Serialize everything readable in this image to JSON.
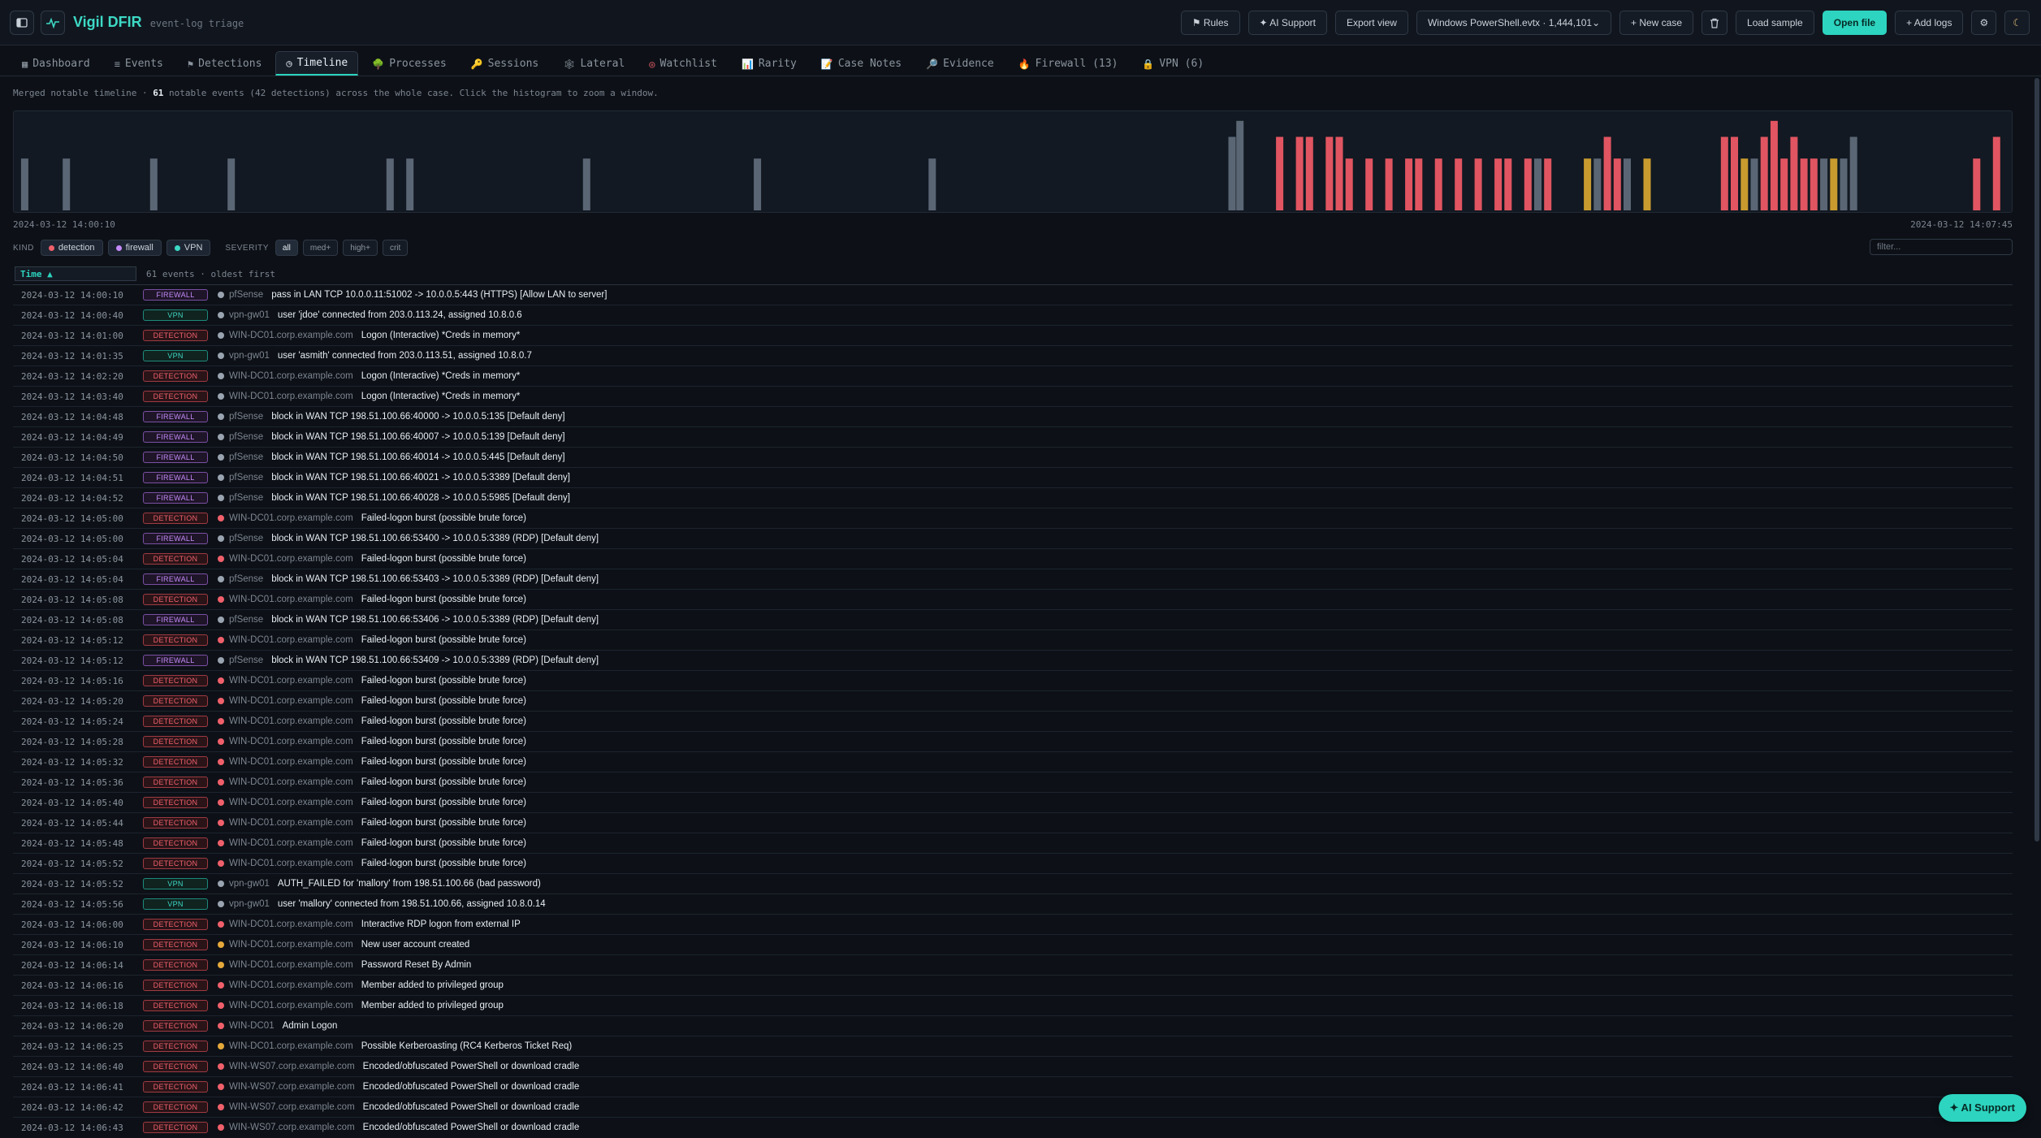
{
  "app": {
    "name": "Vigil DFIR",
    "subtitle": "event-log triage"
  },
  "toolbar": {
    "rules": "⚑ Rules",
    "ai_support": "✦ AI Support",
    "export_view": "Export view",
    "dataset_select": "Windows PowerShell.evtx · 1,444,101",
    "new_case": "+ New case",
    "load_sample": "Load sample",
    "open_file": "Open file",
    "add_logs": "+ Add logs"
  },
  "tabs": [
    {
      "icon": "▦",
      "label": "Dashboard"
    },
    {
      "icon": "≡",
      "label": "Events"
    },
    {
      "icon": "⚑",
      "label": "Detections"
    },
    {
      "icon": "◷",
      "label": "Timeline"
    },
    {
      "icon": "🌳",
      "label": "Processes"
    },
    {
      "icon": "🔑",
      "label": "Sessions"
    },
    {
      "icon": "🕸",
      "label": "Lateral"
    },
    {
      "icon": "◎",
      "label": "Watchlist"
    },
    {
      "icon": "📊",
      "label": "Rarity"
    },
    {
      "icon": "📝",
      "label": "Case Notes"
    },
    {
      "icon": "🔎",
      "label": "Evidence"
    },
    {
      "icon": "🔥",
      "label": "Firewall (13)"
    },
    {
      "icon": "🔒",
      "label": "VPN (6)"
    }
  ],
  "summary": {
    "prefix": "Merged notable timeline · ",
    "count": "61",
    "suffix": " notable events (42 detections) across the whole case. Click the histogram to zoom a window."
  },
  "histogram": {
    "start_label": "2024-03-12 14:00:10",
    "end_label": "2024-03-12 14:07:45",
    "colors": {
      "low": "#5b6675",
      "medium": "#c99a2e",
      "high": "#e05561"
    },
    "buckets": [
      {
        "t": 0.002,
        "v": 0.55,
        "sev": "low"
      },
      {
        "t": 0.023,
        "v": 0.55,
        "sev": "low"
      },
      {
        "t": 0.067,
        "v": 0.55,
        "sev": "low"
      },
      {
        "t": 0.106,
        "v": 0.55,
        "sev": "low"
      },
      {
        "t": 0.186,
        "v": 0.55,
        "sev": "low"
      },
      {
        "t": 0.196,
        "v": 0.55,
        "sev": "low"
      },
      {
        "t": 0.285,
        "v": 0.55,
        "sev": "low"
      },
      {
        "t": 0.371,
        "v": 0.55,
        "sev": "low"
      },
      {
        "t": 0.459,
        "v": 0.55,
        "sev": "low"
      },
      {
        "t": 0.61,
        "v": 0.78,
        "sev": "low"
      },
      {
        "t": 0.614,
        "v": 0.95,
        "sev": "low"
      },
      {
        "t": 0.634,
        "v": 0.78,
        "sev": "high"
      },
      {
        "t": 0.644,
        "v": 0.78,
        "sev": "high"
      },
      {
        "t": 0.649,
        "v": 0.78,
        "sev": "high"
      },
      {
        "t": 0.659,
        "v": 0.78,
        "sev": "high"
      },
      {
        "t": 0.664,
        "v": 0.78,
        "sev": "high"
      },
      {
        "t": 0.669,
        "v": 0.55,
        "sev": "high"
      },
      {
        "t": 0.679,
        "v": 0.55,
        "sev": "high"
      },
      {
        "t": 0.689,
        "v": 0.55,
        "sev": "high"
      },
      {
        "t": 0.699,
        "v": 0.55,
        "sev": "high"
      },
      {
        "t": 0.704,
        "v": 0.55,
        "sev": "high"
      },
      {
        "t": 0.714,
        "v": 0.55,
        "sev": "high"
      },
      {
        "t": 0.724,
        "v": 0.55,
        "sev": "high"
      },
      {
        "t": 0.734,
        "v": 0.55,
        "sev": "high"
      },
      {
        "t": 0.744,
        "v": 0.55,
        "sev": "high"
      },
      {
        "t": 0.749,
        "v": 0.55,
        "sev": "high"
      },
      {
        "t": 0.759,
        "v": 0.55,
        "sev": "high"
      },
      {
        "t": 0.764,
        "v": 0.55,
        "sev": "low"
      },
      {
        "t": 0.769,
        "v": 0.55,
        "sev": "high"
      },
      {
        "t": 0.789,
        "v": 0.55,
        "sev": "medium"
      },
      {
        "t": 0.794,
        "v": 0.55,
        "sev": "low"
      },
      {
        "t": 0.799,
        "v": 0.78,
        "sev": "high"
      },
      {
        "t": 0.804,
        "v": 0.55,
        "sev": "high"
      },
      {
        "t": 0.809,
        "v": 0.55,
        "sev": "low"
      },
      {
        "t": 0.819,
        "v": 0.55,
        "sev": "medium"
      },
      {
        "t": 0.858,
        "v": 0.78,
        "sev": "high"
      },
      {
        "t": 0.863,
        "v": 0.78,
        "sev": "high"
      },
      {
        "t": 0.868,
        "v": 0.55,
        "sev": "medium"
      },
      {
        "t": 0.873,
        "v": 0.55,
        "sev": "low"
      },
      {
        "t": 0.878,
        "v": 0.78,
        "sev": "high"
      },
      {
        "t": 0.883,
        "v": 0.95,
        "sev": "high"
      },
      {
        "t": 0.888,
        "v": 0.55,
        "sev": "high"
      },
      {
        "t": 0.893,
        "v": 0.78,
        "sev": "high"
      },
      {
        "t": 0.898,
        "v": 0.55,
        "sev": "high"
      },
      {
        "t": 0.903,
        "v": 0.55,
        "sev": "high"
      },
      {
        "t": 0.908,
        "v": 0.55,
        "sev": "low"
      },
      {
        "t": 0.913,
        "v": 0.55,
        "sev": "medium"
      },
      {
        "t": 0.918,
        "v": 0.55,
        "sev": "low"
      },
      {
        "t": 0.923,
        "v": 0.78,
        "sev": "low"
      },
      {
        "t": 0.985,
        "v": 0.55,
        "sev": "high"
      },
      {
        "t": 0.995,
        "v": 0.78,
        "sev": "high"
      }
    ]
  },
  "filters": {
    "kind_label": "KIND",
    "kinds": [
      {
        "label": "detection",
        "color": "#f0606b"
      },
      {
        "label": "firewall",
        "color": "#c58af9"
      },
      {
        "label": "VPN",
        "color": "#3dd9c5"
      }
    ],
    "severity_label": "SEVERITY",
    "severities": [
      "all",
      "med+",
      "high+",
      "crit"
    ],
    "filter_placeholder": "filter..."
  },
  "table": {
    "sort_label": "Time ▲",
    "count_text": "61 events · oldest first",
    "severity_colors": {
      "info": "#9aa4b1",
      "medium": "#e5a93b",
      "high": "#f0606b"
    },
    "rows": [
      {
        "time": "2024-03-12 14:00:10",
        "kind": "FIREWALL",
        "sev": "info",
        "host": "pfSense",
        "msg": "pass in LAN TCP 10.0.0.11:51002 -> 10.0.0.5:443 (HTTPS) [Allow LAN to server]"
      },
      {
        "time": "2024-03-12 14:00:40",
        "kind": "VPN",
        "sev": "info",
        "host": "vpn-gw01",
        "msg": "user 'jdoe' connected from 203.0.113.24, assigned 10.8.0.6"
      },
      {
        "time": "2024-03-12 14:01:00",
        "kind": "DETECTION",
        "sev": "info",
        "host": "WIN-DC01.corp.example.com",
        "msg": "Logon (Interactive) *Creds in memory*"
      },
      {
        "time": "2024-03-12 14:01:35",
        "kind": "VPN",
        "sev": "info",
        "host": "vpn-gw01",
        "msg": "user 'asmith' connected from 203.0.113.51, assigned 10.8.0.7"
      },
      {
        "time": "2024-03-12 14:02:20",
        "kind": "DETECTION",
        "sev": "info",
        "host": "WIN-DC01.corp.example.com",
        "msg": "Logon (Interactive) *Creds in memory*"
      },
      {
        "time": "2024-03-12 14:03:40",
        "kind": "DETECTION",
        "sev": "info",
        "host": "WIN-DC01.corp.example.com",
        "msg": "Logon (Interactive) *Creds in memory*"
      },
      {
        "time": "2024-03-12 14:04:48",
        "kind": "FIREWALL",
        "sev": "info",
        "host": "pfSense",
        "msg": "block in WAN TCP 198.51.100.66:40000 -> 10.0.0.5:135 [Default deny]"
      },
      {
        "time": "2024-03-12 14:04:49",
        "kind": "FIREWALL",
        "sev": "info",
        "host": "pfSense",
        "msg": "block in WAN TCP 198.51.100.66:40007 -> 10.0.0.5:139 [Default deny]"
      },
      {
        "time": "2024-03-12 14:04:50",
        "kind": "FIREWALL",
        "sev": "info",
        "host": "pfSense",
        "msg": "block in WAN TCP 198.51.100.66:40014 -> 10.0.0.5:445 [Default deny]"
      },
      {
        "time": "2024-03-12 14:04:51",
        "kind": "FIREWALL",
        "sev": "info",
        "host": "pfSense",
        "msg": "block in WAN TCP 198.51.100.66:40021 -> 10.0.0.5:3389 [Default deny]"
      },
      {
        "time": "2024-03-12 14:04:52",
        "kind": "FIREWALL",
        "sev": "info",
        "host": "pfSense",
        "msg": "block in WAN TCP 198.51.100.66:40028 -> 10.0.0.5:5985 [Default deny]"
      },
      {
        "time": "2024-03-12 14:05:00",
        "kind": "DETECTION",
        "sev": "high",
        "host": "WIN-DC01.corp.example.com",
        "msg": "Failed-logon burst (possible brute force)"
      },
      {
        "time": "2024-03-12 14:05:00",
        "kind": "FIREWALL",
        "sev": "info",
        "host": "pfSense",
        "msg": "block in WAN TCP 198.51.100.66:53400 -> 10.0.0.5:3389 (RDP) [Default deny]"
      },
      {
        "time": "2024-03-12 14:05:04",
        "kind": "DETECTION",
        "sev": "high",
        "host": "WIN-DC01.corp.example.com",
        "msg": "Failed-logon burst (possible brute force)"
      },
      {
        "time": "2024-03-12 14:05:04",
        "kind": "FIREWALL",
        "sev": "info",
        "host": "pfSense",
        "msg": "block in WAN TCP 198.51.100.66:53403 -> 10.0.0.5:3389 (RDP) [Default deny]"
      },
      {
        "time": "2024-03-12 14:05:08",
        "kind": "DETECTION",
        "sev": "high",
        "host": "WIN-DC01.corp.example.com",
        "msg": "Failed-logon burst (possible brute force)"
      },
      {
        "time": "2024-03-12 14:05:08",
        "kind": "FIREWALL",
        "sev": "info",
        "host": "pfSense",
        "msg": "block in WAN TCP 198.51.100.66:53406 -> 10.0.0.5:3389 (RDP) [Default deny]"
      },
      {
        "time": "2024-03-12 14:05:12",
        "kind": "DETECTION",
        "sev": "high",
        "host": "WIN-DC01.corp.example.com",
        "msg": "Failed-logon burst (possible brute force)"
      },
      {
        "time": "2024-03-12 14:05:12",
        "kind": "FIREWALL",
        "sev": "info",
        "host": "pfSense",
        "msg": "block in WAN TCP 198.51.100.66:53409 -> 10.0.0.5:3389 (RDP) [Default deny]"
      },
      {
        "time": "2024-03-12 14:05:16",
        "kind": "DETECTION",
        "sev": "high",
        "host": "WIN-DC01.corp.example.com",
        "msg": "Failed-logon burst (possible brute force)"
      },
      {
        "time": "2024-03-12 14:05:20",
        "kind": "DETECTION",
        "sev": "high",
        "host": "WIN-DC01.corp.example.com",
        "msg": "Failed-logon burst (possible brute force)"
      },
      {
        "time": "2024-03-12 14:05:24",
        "kind": "DETECTION",
        "sev": "high",
        "host": "WIN-DC01.corp.example.com",
        "msg": "Failed-logon burst (possible brute force)"
      },
      {
        "time": "2024-03-12 14:05:28",
        "kind": "DETECTION",
        "sev": "high",
        "host": "WIN-DC01.corp.example.com",
        "msg": "Failed-logon burst (possible brute force)"
      },
      {
        "time": "2024-03-12 14:05:32",
        "kind": "DETECTION",
        "sev": "high",
        "host": "WIN-DC01.corp.example.com",
        "msg": "Failed-logon burst (possible brute force)"
      },
      {
        "time": "2024-03-12 14:05:36",
        "kind": "DETECTION",
        "sev": "high",
        "host": "WIN-DC01.corp.example.com",
        "msg": "Failed-logon burst (possible brute force)"
      },
      {
        "time": "2024-03-12 14:05:40",
        "kind": "DETECTION",
        "sev": "high",
        "host": "WIN-DC01.corp.example.com",
        "msg": "Failed-logon burst (possible brute force)"
      },
      {
        "time": "2024-03-12 14:05:44",
        "kind": "DETECTION",
        "sev": "high",
        "host": "WIN-DC01.corp.example.com",
        "msg": "Failed-logon burst (possible brute force)"
      },
      {
        "time": "2024-03-12 14:05:48",
        "kind": "DETECTION",
        "sev": "high",
        "host": "WIN-DC01.corp.example.com",
        "msg": "Failed-logon burst (possible brute force)"
      },
      {
        "time": "2024-03-12 14:05:52",
        "kind": "DETECTION",
        "sev": "high",
        "host": "WIN-DC01.corp.example.com",
        "msg": "Failed-logon burst (possible brute force)"
      },
      {
        "time": "2024-03-12 14:05:52",
        "kind": "VPN",
        "sev": "info",
        "host": "vpn-gw01",
        "msg": "AUTH_FAILED for 'mallory' from 198.51.100.66 (bad password)"
      },
      {
        "time": "2024-03-12 14:05:56",
        "kind": "VPN",
        "sev": "info",
        "host": "vpn-gw01",
        "msg": "user 'mallory' connected from 198.51.100.66, assigned 10.8.0.14"
      },
      {
        "time": "2024-03-12 14:06:00",
        "kind": "DETECTION",
        "sev": "high",
        "host": "WIN-DC01.corp.example.com",
        "msg": "Interactive RDP logon from external IP"
      },
      {
        "time": "2024-03-12 14:06:10",
        "kind": "DETECTION",
        "sev": "medium",
        "host": "WIN-DC01.corp.example.com",
        "msg": "New user account created"
      },
      {
        "time": "2024-03-12 14:06:14",
        "kind": "DETECTION",
        "sev": "medium",
        "host": "WIN-DC01.corp.example.com",
        "msg": "Password Reset By Admin"
      },
      {
        "time": "2024-03-12 14:06:16",
        "kind": "DETECTION",
        "sev": "high",
        "host": "WIN-DC01.corp.example.com",
        "msg": "Member added to privileged group"
      },
      {
        "time": "2024-03-12 14:06:18",
        "kind": "DETECTION",
        "sev": "high",
        "host": "WIN-DC01.corp.example.com",
        "msg": "Member added to privileged group"
      },
      {
        "time": "2024-03-12 14:06:20",
        "kind": "DETECTION",
        "sev": "high",
        "host": "WIN-DC01",
        "msg": "Admin Logon"
      },
      {
        "time": "2024-03-12 14:06:25",
        "kind": "DETECTION",
        "sev": "medium",
        "host": "WIN-DC01.corp.example.com",
        "msg": "Possible Kerberoasting (RC4 Kerberos Ticket Req)"
      },
      {
        "time": "2024-03-12 14:06:40",
        "kind": "DETECTION",
        "sev": "high",
        "host": "WIN-WS07.corp.example.com",
        "msg": "Encoded/obfuscated PowerShell or download cradle"
      },
      {
        "time": "2024-03-12 14:06:41",
        "kind": "DETECTION",
        "sev": "high",
        "host": "WIN-WS07.corp.example.com",
        "msg": "Encoded/obfuscated PowerShell or download cradle"
      },
      {
        "time": "2024-03-12 14:06:42",
        "kind": "DETECTION",
        "sev": "high",
        "host": "WIN-WS07.corp.example.com",
        "msg": "Encoded/obfuscated PowerShell or download cradle"
      },
      {
        "time": "2024-03-12 14:06:43",
        "kind": "DETECTION",
        "sev": "high",
        "host": "WIN-WS07.corp.example.com",
        "msg": "Encoded/obfuscated PowerShell or download cradle"
      }
    ]
  },
  "fab": {
    "label": "✦ AI Support"
  }
}
